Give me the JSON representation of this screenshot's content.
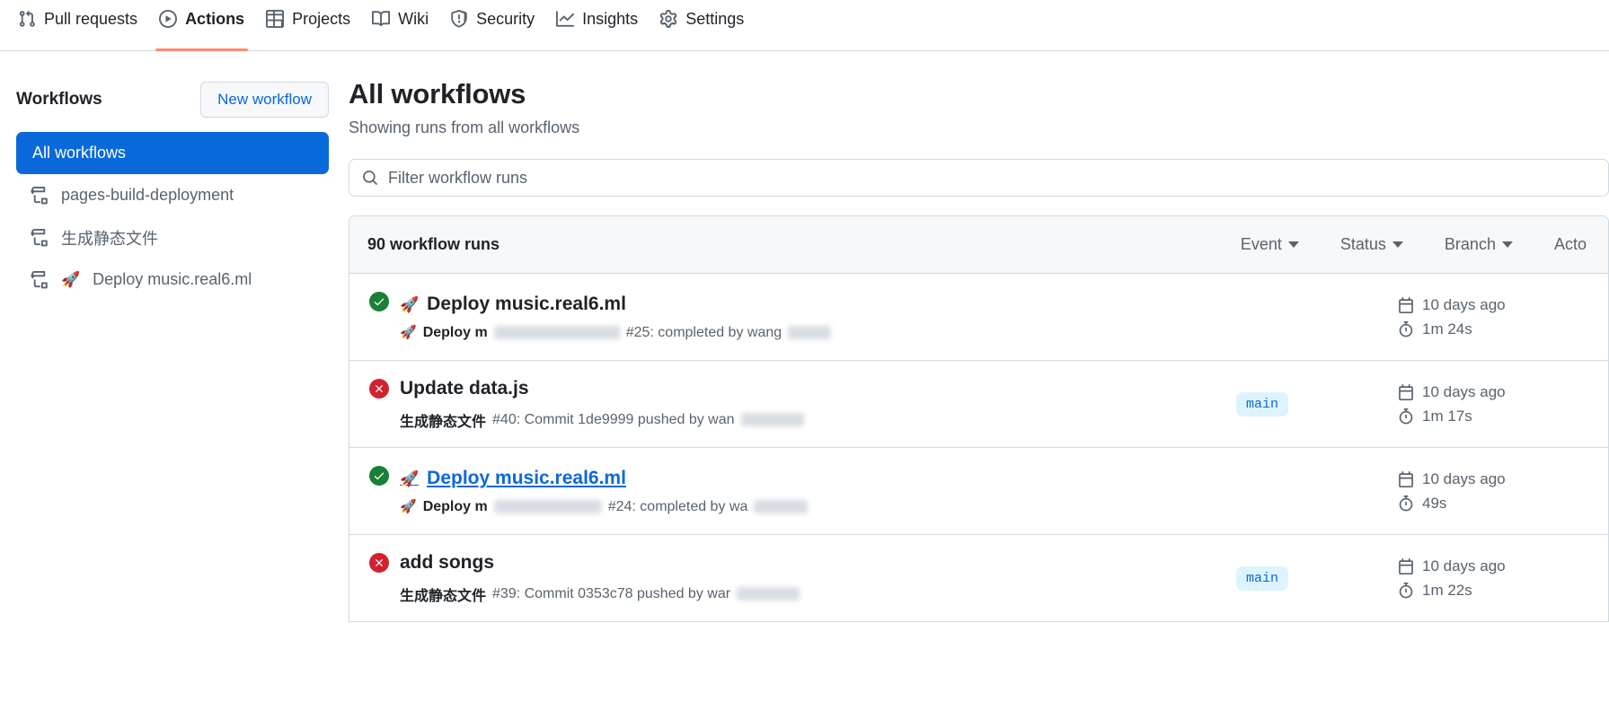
{
  "repo_nav": {
    "tabs": [
      {
        "label": "Pull requests",
        "icon": "git-pull-request-icon",
        "selected": false
      },
      {
        "label": "Actions",
        "icon": "play-circle-icon",
        "selected": true
      },
      {
        "label": "Projects",
        "icon": "table-icon",
        "selected": false
      },
      {
        "label": "Wiki",
        "icon": "book-icon",
        "selected": false
      },
      {
        "label": "Security",
        "icon": "shield-icon",
        "selected": false
      },
      {
        "label": "Insights",
        "icon": "graph-icon",
        "selected": false
      },
      {
        "label": "Settings",
        "icon": "gear-icon",
        "selected": false
      }
    ],
    "accent_underline": "#fd8c73"
  },
  "sidebar": {
    "title": "Workflows",
    "new_workflow_label": "New workflow",
    "items": [
      {
        "label": "All workflows",
        "active": true,
        "icon": null,
        "emoji": null
      },
      {
        "label": "pages-build-deployment",
        "active": false,
        "icon": "workflow-icon",
        "emoji": null
      },
      {
        "label": "生成静态文件",
        "active": false,
        "icon": "workflow-icon",
        "emoji": null
      },
      {
        "label": "Deploy music.real6.ml",
        "active": false,
        "icon": "workflow-icon",
        "emoji": "🚀"
      }
    ],
    "active_color": "#0969da"
  },
  "main": {
    "title": "All workflows",
    "subtitle": "Showing runs from all workflows",
    "filter": {
      "placeholder": "Filter workflow runs",
      "value": "",
      "icon": "search-icon"
    },
    "runs_header": {
      "count_label": "90 workflow runs",
      "filters": [
        {
          "label": "Event",
          "icon": "chevron-down-icon"
        },
        {
          "label": "Status",
          "icon": "chevron-down-icon"
        },
        {
          "label": "Branch",
          "icon": "chevron-down-icon"
        },
        {
          "label": "Acto",
          "icon": "chevron-down-icon"
        }
      ]
    },
    "runs": [
      {
        "status": "success",
        "status_icon": "check-circle-icon",
        "emoji": "🚀",
        "title": "Deploy music.real6.ml",
        "linked": false,
        "sub_emoji": "🚀",
        "sub_workflow": "Deploy m",
        "sub_text": "#25: completed by wang",
        "branch": "",
        "date": "10 days ago",
        "duration": "1m 24s",
        "date_icon": "calendar-icon",
        "duration_icon": "stopwatch-icon"
      },
      {
        "status": "failure",
        "status_icon": "x-circle-icon",
        "emoji": "",
        "title": "Update data.js",
        "linked": false,
        "sub_emoji": "",
        "sub_workflow": "生成静态文件",
        "sub_text": "#40: Commit 1de9999 pushed by wan",
        "branch": "main",
        "date": "10 days ago",
        "duration": "1m 17s",
        "date_icon": "calendar-icon",
        "duration_icon": "stopwatch-icon"
      },
      {
        "status": "success",
        "status_icon": "check-circle-icon",
        "emoji": "🚀",
        "title": "Deploy music.real6.ml",
        "linked": true,
        "sub_emoji": "🚀",
        "sub_workflow": "Deploy m",
        "sub_text": "#24: completed by wa",
        "branch": "",
        "date": "10 days ago",
        "duration": "49s",
        "date_icon": "calendar-icon",
        "duration_icon": "stopwatch-icon"
      },
      {
        "status": "failure",
        "status_icon": "x-circle-icon",
        "emoji": "",
        "title": "add songs",
        "linked": false,
        "sub_emoji": "",
        "sub_workflow": "生成静态文件",
        "sub_text": "#39: Commit 0353c78 pushed by war",
        "branch": "main",
        "date": "10 days ago",
        "duration": "1m 22s",
        "date_icon": "calendar-icon",
        "duration_icon": "stopwatch-icon"
      }
    ]
  },
  "colors": {
    "success": "#1a7f37",
    "failure": "#cf222e",
    "link": "#0969da",
    "muted": "#59636e",
    "border": "#d1d9e0",
    "header_bg": "#f6f8fa",
    "badge_bg": "#ddf4ff"
  }
}
